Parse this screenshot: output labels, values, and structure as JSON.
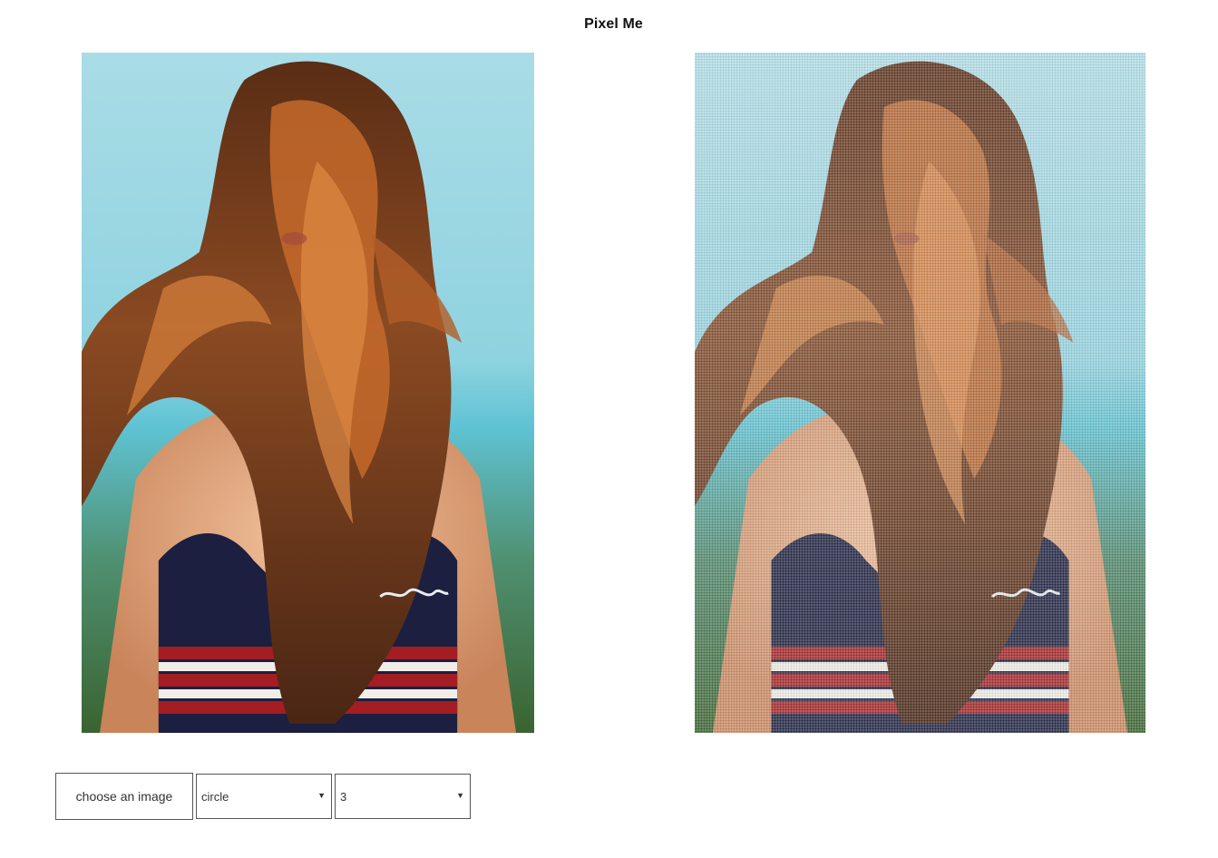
{
  "app": {
    "title": "Pixel Me"
  },
  "controls": {
    "file_button_label": "choose an image",
    "shape_select": {
      "selected": "circle"
    },
    "size_select": {
      "selected": "3"
    }
  },
  "images": {
    "original": {
      "icon": "photo-original"
    },
    "pixelated": {
      "icon": "photo-pixelated"
    }
  },
  "colors": {
    "sky": "#a9dce6",
    "hair": "#7a3f1c",
    "skin": "#e2a37e",
    "top": "#1c1f3f",
    "stripe_red": "#a31d22",
    "land": "#3f6a33",
    "border": "#555555"
  }
}
